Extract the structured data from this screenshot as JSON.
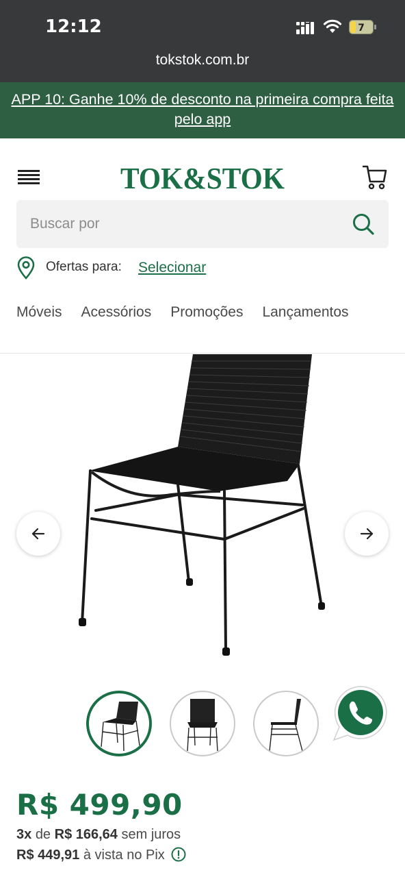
{
  "status_bar": {
    "time": "12:12",
    "battery": "7",
    "url": "tokstok.com.br"
  },
  "promo": {
    "text": "APP 10: Ganhe 10% de desconto na primeira compra feita pelo app"
  },
  "header": {
    "logo_text": "TOK&STOK",
    "search_placeholder": "Buscar por",
    "offers_label": "Ofertas para:",
    "offers_link": "Selecionar"
  },
  "nav": {
    "items": [
      "Móveis",
      "Acessórios",
      "Promoções",
      "Lançamentos"
    ]
  },
  "product": {
    "price": "R$ 499,90",
    "installments_count": "3x",
    "installments_of": "de",
    "installment_value": "R$ 166,64",
    "installments_suffix": "sem juros",
    "pix_price": "R$ 449,91",
    "pix_suffix": "à vista no Pix"
  },
  "colors": {
    "brand_green": "#1b6f47",
    "banner_green": "#2f5f43",
    "status_bar": "#38393a"
  }
}
